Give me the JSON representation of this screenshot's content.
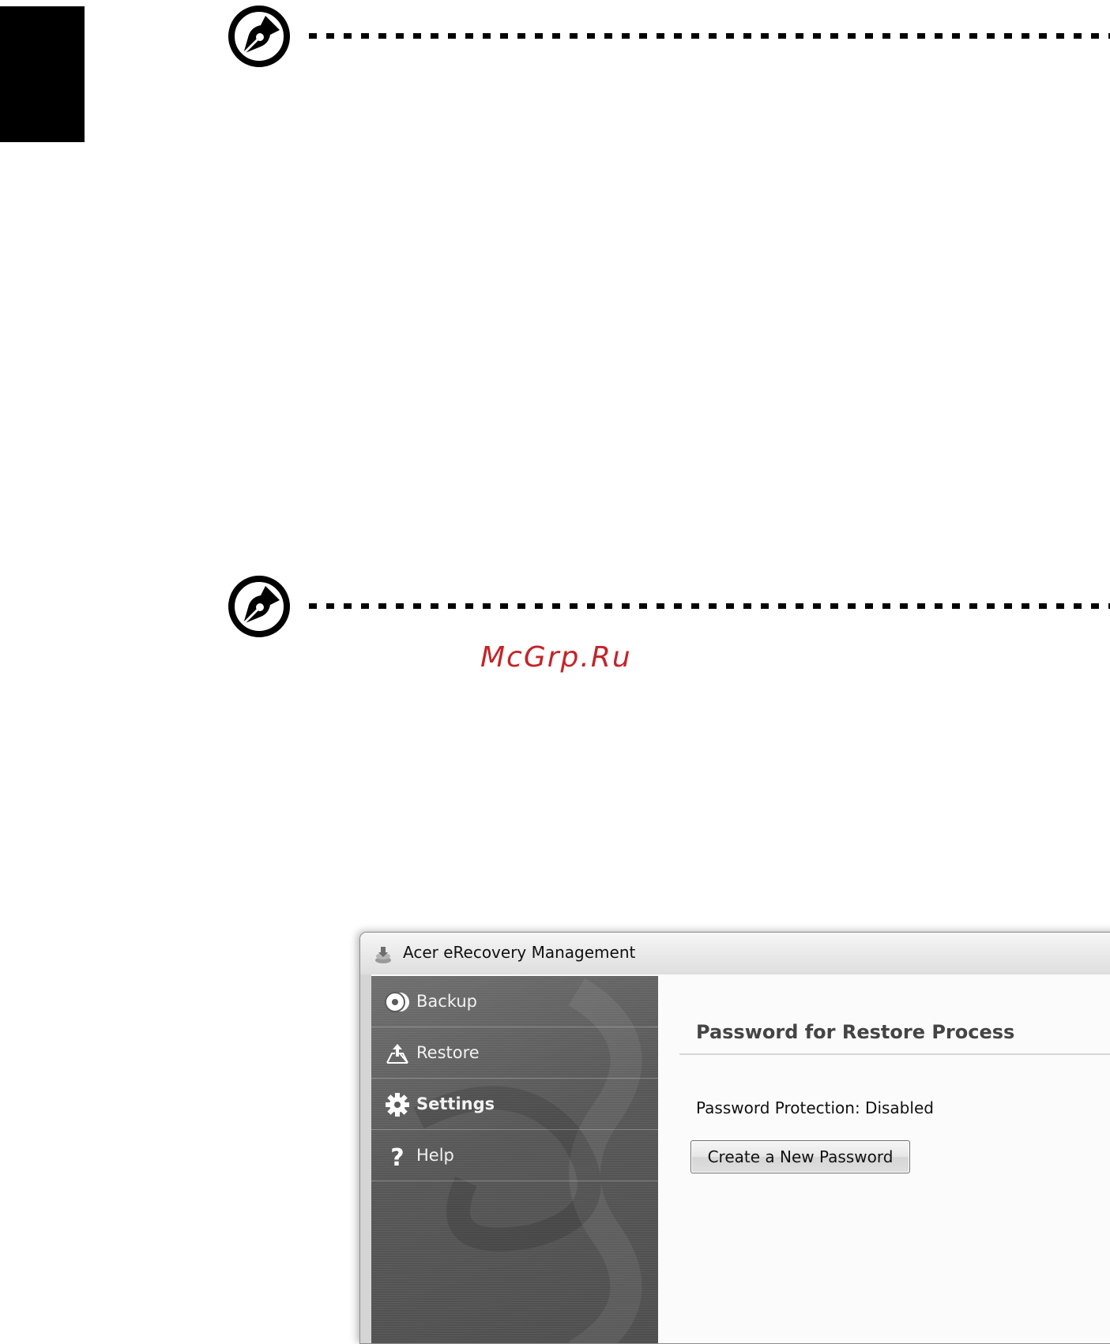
{
  "page": {
    "watermark": "McGrp.Ru"
  },
  "window": {
    "title": "Acer eRecovery Management",
    "sidebar": {
      "items": [
        {
          "label": "Backup",
          "icon": "disc-icon",
          "active": false
        },
        {
          "label": "Restore",
          "icon": "restore-icon",
          "active": false
        },
        {
          "label": "Settings",
          "icon": "gear-icon",
          "active": true
        },
        {
          "label": "Help",
          "icon": "question-icon",
          "active": false
        }
      ]
    },
    "content": {
      "section_title": "Password for Restore Process",
      "status": "Password Protection: Disabled",
      "create_button": "Create a New Password"
    }
  },
  "colors": {
    "watermark": "#c4242a",
    "sidebar": "#5a5a5a",
    "side_tab": "#000000"
  }
}
